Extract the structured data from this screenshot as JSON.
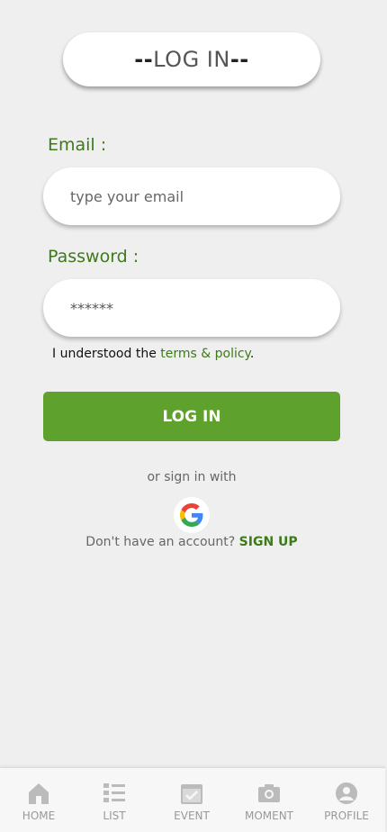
{
  "header": {
    "title": "LOG IN",
    "dash_left": "--",
    "dash_right": "--"
  },
  "email": {
    "label": "Email :",
    "placeholder": "type your email"
  },
  "password": {
    "label": "Password :",
    "value": "******"
  },
  "terms": {
    "prefix": "I understood the ",
    "link": "terms & policy",
    "suffix": "."
  },
  "login_button": "LOG IN",
  "social": {
    "text": "or sign in with",
    "provider_icon": "google-icon"
  },
  "signup": {
    "prefix": "Don't have an account? ",
    "link": "SIGN UP"
  },
  "nav": [
    {
      "label": "HOME",
      "icon": "home-icon"
    },
    {
      "label": "LIST",
      "icon": "list-icon"
    },
    {
      "label": "EVENT",
      "icon": "event-icon"
    },
    {
      "label": "MOMENT",
      "icon": "camera-icon"
    },
    {
      "label": "PROFILE",
      "icon": "profile-icon"
    }
  ],
  "colors": {
    "accent": "#5fa12d",
    "label_green": "#3d7a1a",
    "background": "#efefef",
    "nav_icon": "#bbbbbb"
  }
}
